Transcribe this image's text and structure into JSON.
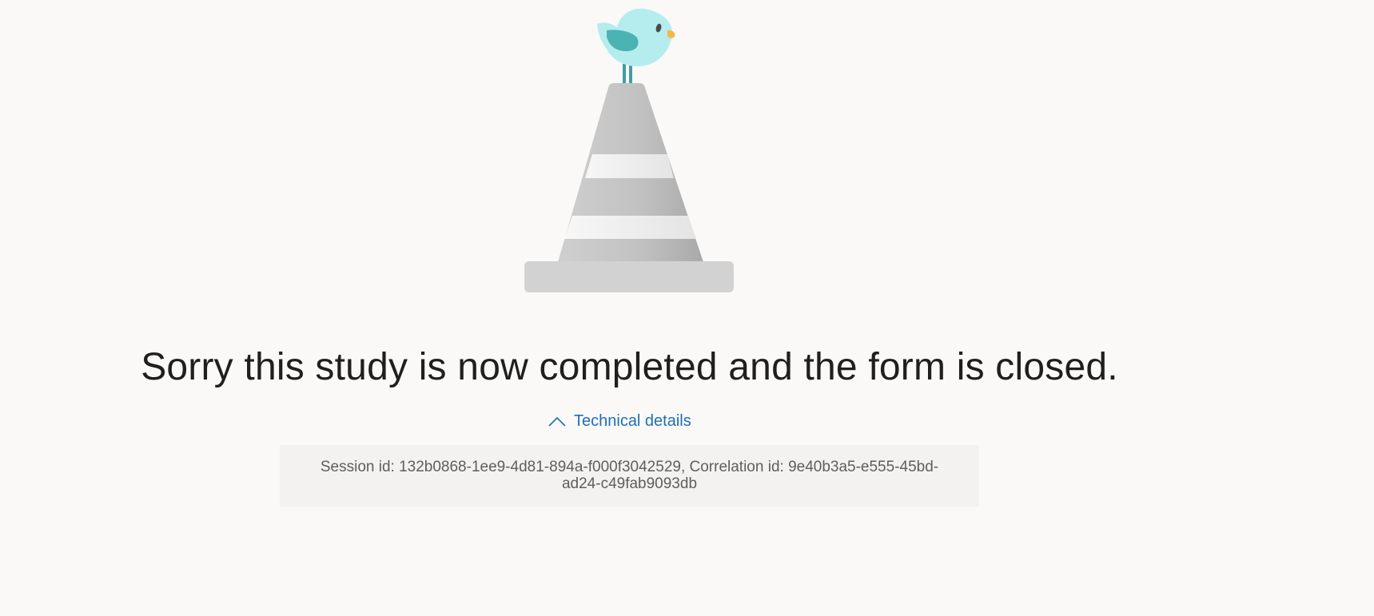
{
  "message": {
    "title": "Sorry this study is now completed and the form is closed."
  },
  "technical_details": {
    "toggle_label": "Technical details",
    "toggle_icon": "chevron-up-icon",
    "session_text": "Session id: 132b0868-1ee9-4d81-894a-f000f3042529, Correlation id: 9e40b3a5-e555-45bd-ad24-c49fab9093db"
  },
  "illustration": {
    "icon": "bird-on-traffic-cone",
    "colors": {
      "bird_body": "#b5edef",
      "bird_wing": "#4bb3b3",
      "bird_beak": "#f5b942",
      "cone": "#c4c4c4",
      "cone_stripe": "#f2f2f2",
      "cone_base": "#d2d2d2"
    }
  },
  "colors": {
    "background": "#faf9f8",
    "title_text": "#201f1e",
    "link": "#1e6fb8",
    "details_background": "#f3f2f1",
    "details_text": "#605e5c"
  }
}
